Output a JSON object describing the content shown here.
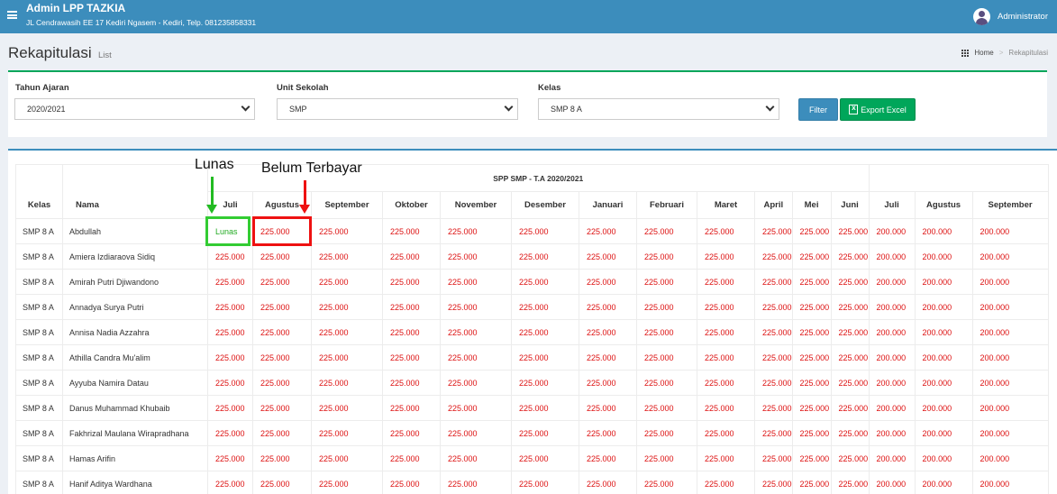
{
  "app": {
    "title": "Admin LPP TAZKIA",
    "address": "JL Cendrawasih EE 17 Kediri Ngasem - Kediri, Telp. 081235858331",
    "user": "Administrator"
  },
  "page": {
    "title": "Rekapitulasi",
    "subtitle": "List",
    "breadcrumb": [
      "Home",
      "Rekapitulasi"
    ]
  },
  "filters": {
    "tahun_label": "Tahun Ajaran",
    "tahun_value": "2020/2021",
    "unit_label": "Unit Sekolah",
    "unit_value": "SMP",
    "kelas_label": "Kelas",
    "kelas_value": "SMP 8 A",
    "filter_button": "Filter",
    "export_button": "Export Excel"
  },
  "table": {
    "group_header": "SPP SMP - T.A 2020/2021",
    "col_kelas": "Kelas",
    "col_nama": "Nama",
    "months": [
      "Juli",
      "Agustus",
      "September",
      "Oktober",
      "November",
      "Desember",
      "Januari",
      "Februari",
      "Maret",
      "April",
      "Mei",
      "Juni",
      "Juli",
      "Agustus",
      "September"
    ],
    "rows": [
      {
        "kelas": "SMP 8 A",
        "nama": "Abdullah",
        "values": [
          "Lunas",
          "225.000",
          "225.000",
          "225.000",
          "225.000",
          "225.000",
          "225.000",
          "225.000",
          "225.000",
          "225.000",
          "225.000",
          "225.000",
          "200.000",
          "200.000",
          "200.000"
        ]
      },
      {
        "kelas": "SMP 8 A",
        "nama": "Amiera Izdiaraova Sidiq",
        "values": [
          "225.000",
          "225.000",
          "225.000",
          "225.000",
          "225.000",
          "225.000",
          "225.000",
          "225.000",
          "225.000",
          "225.000",
          "225.000",
          "225.000",
          "200.000",
          "200.000",
          "200.000"
        ]
      },
      {
        "kelas": "SMP 8 A",
        "nama": "Amirah Putri Djiwandono",
        "values": [
          "225.000",
          "225.000",
          "225.000",
          "225.000",
          "225.000",
          "225.000",
          "225.000",
          "225.000",
          "225.000",
          "225.000",
          "225.000",
          "225.000",
          "200.000",
          "200.000",
          "200.000"
        ]
      },
      {
        "kelas": "SMP 8 A",
        "nama": "Annadya Surya Putri",
        "values": [
          "225.000",
          "225.000",
          "225.000",
          "225.000",
          "225.000",
          "225.000",
          "225.000",
          "225.000",
          "225.000",
          "225.000",
          "225.000",
          "225.000",
          "200.000",
          "200.000",
          "200.000"
        ]
      },
      {
        "kelas": "SMP 8 A",
        "nama": "Annisa Nadia Azzahra",
        "values": [
          "225.000",
          "225.000",
          "225.000",
          "225.000",
          "225.000",
          "225.000",
          "225.000",
          "225.000",
          "225.000",
          "225.000",
          "225.000",
          "225.000",
          "200.000",
          "200.000",
          "200.000"
        ]
      },
      {
        "kelas": "SMP 8 A",
        "nama": "Athilla Candra Mu'alim",
        "values": [
          "225.000",
          "225.000",
          "225.000",
          "225.000",
          "225.000",
          "225.000",
          "225.000",
          "225.000",
          "225.000",
          "225.000",
          "225.000",
          "225.000",
          "200.000",
          "200.000",
          "200.000"
        ]
      },
      {
        "kelas": "SMP 8 A",
        "nama": "Ayyuba Namira Datau",
        "values": [
          "225.000",
          "225.000",
          "225.000",
          "225.000",
          "225.000",
          "225.000",
          "225.000",
          "225.000",
          "225.000",
          "225.000",
          "225.000",
          "225.000",
          "200.000",
          "200.000",
          "200.000"
        ]
      },
      {
        "kelas": "SMP 8 A",
        "nama": "Danus Muhammad Khubaib",
        "values": [
          "225.000",
          "225.000",
          "225.000",
          "225.000",
          "225.000",
          "225.000",
          "225.000",
          "225.000",
          "225.000",
          "225.000",
          "225.000",
          "225.000",
          "200.000",
          "200.000",
          "200.000"
        ]
      },
      {
        "kelas": "SMP 8 A",
        "nama": "Fakhrizal Maulana Wirapradhana",
        "values": [
          "225.000",
          "225.000",
          "225.000",
          "225.000",
          "225.000",
          "225.000",
          "225.000",
          "225.000",
          "225.000",
          "225.000",
          "225.000",
          "225.000",
          "200.000",
          "200.000",
          "200.000"
        ]
      },
      {
        "kelas": "SMP 8 A",
        "nama": "Hamas Arifin",
        "values": [
          "225.000",
          "225.000",
          "225.000",
          "225.000",
          "225.000",
          "225.000",
          "225.000",
          "225.000",
          "225.000",
          "225.000",
          "225.000",
          "225.000",
          "200.000",
          "200.000",
          "200.000"
        ]
      },
      {
        "kelas": "SMP 8 A",
        "nama": "Hanif Aditya Wardhana",
        "values": [
          "225.000",
          "225.000",
          "225.000",
          "225.000",
          "225.000",
          "225.000",
          "225.000",
          "225.000",
          "225.000",
          "225.000",
          "225.000",
          "225.000",
          "200.000",
          "200.000",
          "200.000"
        ]
      }
    ]
  },
  "annotations": {
    "lunas": "Lunas",
    "belum": "Belum Terbayar"
  },
  "colors": {
    "header": "#3c8dbc",
    "paid": "#22aa22",
    "unpaid": "#dd1111",
    "filter_border": "#00a65a"
  }
}
